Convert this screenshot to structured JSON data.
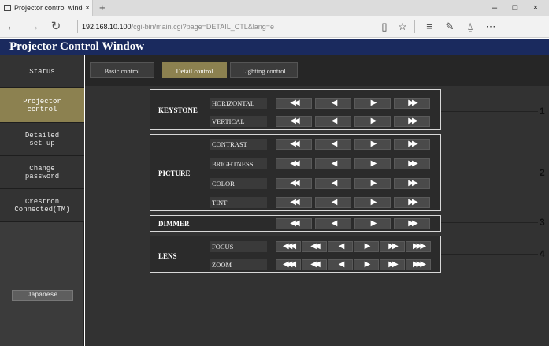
{
  "browser": {
    "tab_title": "Projector control window",
    "tab_close": "×",
    "new_tab": "+",
    "url_host": "192.168.10.100",
    "url_path": "/cgi-bin/main.cgi?page=DETAIL_CTL&lang=e",
    "window_controls": [
      "–",
      "□",
      "×"
    ],
    "nav": {
      "back": "←",
      "forward": "→",
      "refresh": "↻"
    },
    "toolbar_icons": [
      "reading-view-icon",
      "favorite-star-icon",
      "hub-icon",
      "web-note-icon",
      "share-icon",
      "more-icon"
    ],
    "toolbar_glyphs": [
      "▯",
      "☆",
      "≡",
      "✎",
      "⍙",
      "⋯"
    ]
  },
  "app": {
    "title": "Projector Control Window"
  },
  "sidebar": {
    "items": [
      {
        "label": "Status",
        "active": false
      },
      {
        "label": "Projector\ncontrol",
        "active": true
      },
      {
        "label": "Detailed\nset up",
        "active": false
      },
      {
        "label": "Change\npassword",
        "active": false
      },
      {
        "label": "Crestron\nConnected(TM)",
        "active": false
      }
    ],
    "language_button": "Japanese"
  },
  "tabs": [
    {
      "label": "Basic control",
      "active": false
    },
    {
      "label": "Detail control",
      "active": true
    },
    {
      "label": "Lighting control",
      "active": false
    }
  ],
  "groups": {
    "keystone": {
      "label": "KEYSTONE",
      "rows": [
        "HORIZONTAL",
        "VERTICAL"
      ]
    },
    "picture": {
      "label": "PICTURE",
      "rows": [
        "CONTRAST",
        "BRIGHTNESS",
        "COLOR",
        "TINT"
      ]
    },
    "dimmer": {
      "label": "DIMMER"
    },
    "lens": {
      "label": "LENS",
      "rows": [
        "FOCUS",
        "ZOOM"
      ]
    }
  },
  "buttons": {
    "four": [
      "◀◀",
      "◀",
      "▶",
      "▶▶"
    ],
    "six": [
      "◀◀◀",
      "◀◀",
      "◀",
      "▶",
      "▶▶",
      "▶▶▶"
    ]
  },
  "callouts": [
    "1",
    "2",
    "3",
    "4"
  ],
  "colors": {
    "header_bg": "#1a2a5e",
    "active_gold": "#8c8150",
    "panel_dark": "#323232"
  }
}
